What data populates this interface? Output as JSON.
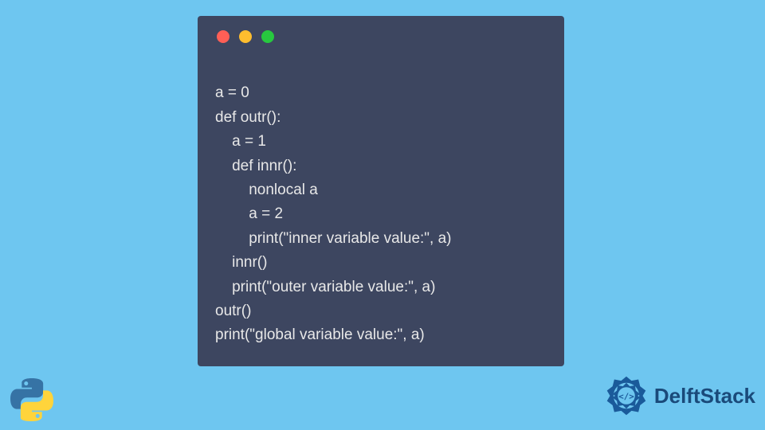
{
  "code": {
    "lines": [
      "a = 0",
      "def outr():",
      "    a = 1",
      "    def innr():",
      "        nonlocal a",
      "        a = 2",
      "        print(\"inner variable value:\", a)",
      "    innr()",
      "    print(\"outer variable value:\", a)",
      "outr()",
      "print(\"global variable value:\", a)"
    ]
  },
  "branding": {
    "delft_text": "DelftStack"
  },
  "icons": {
    "close": "close",
    "minimize": "minimize",
    "maximize": "maximize"
  }
}
